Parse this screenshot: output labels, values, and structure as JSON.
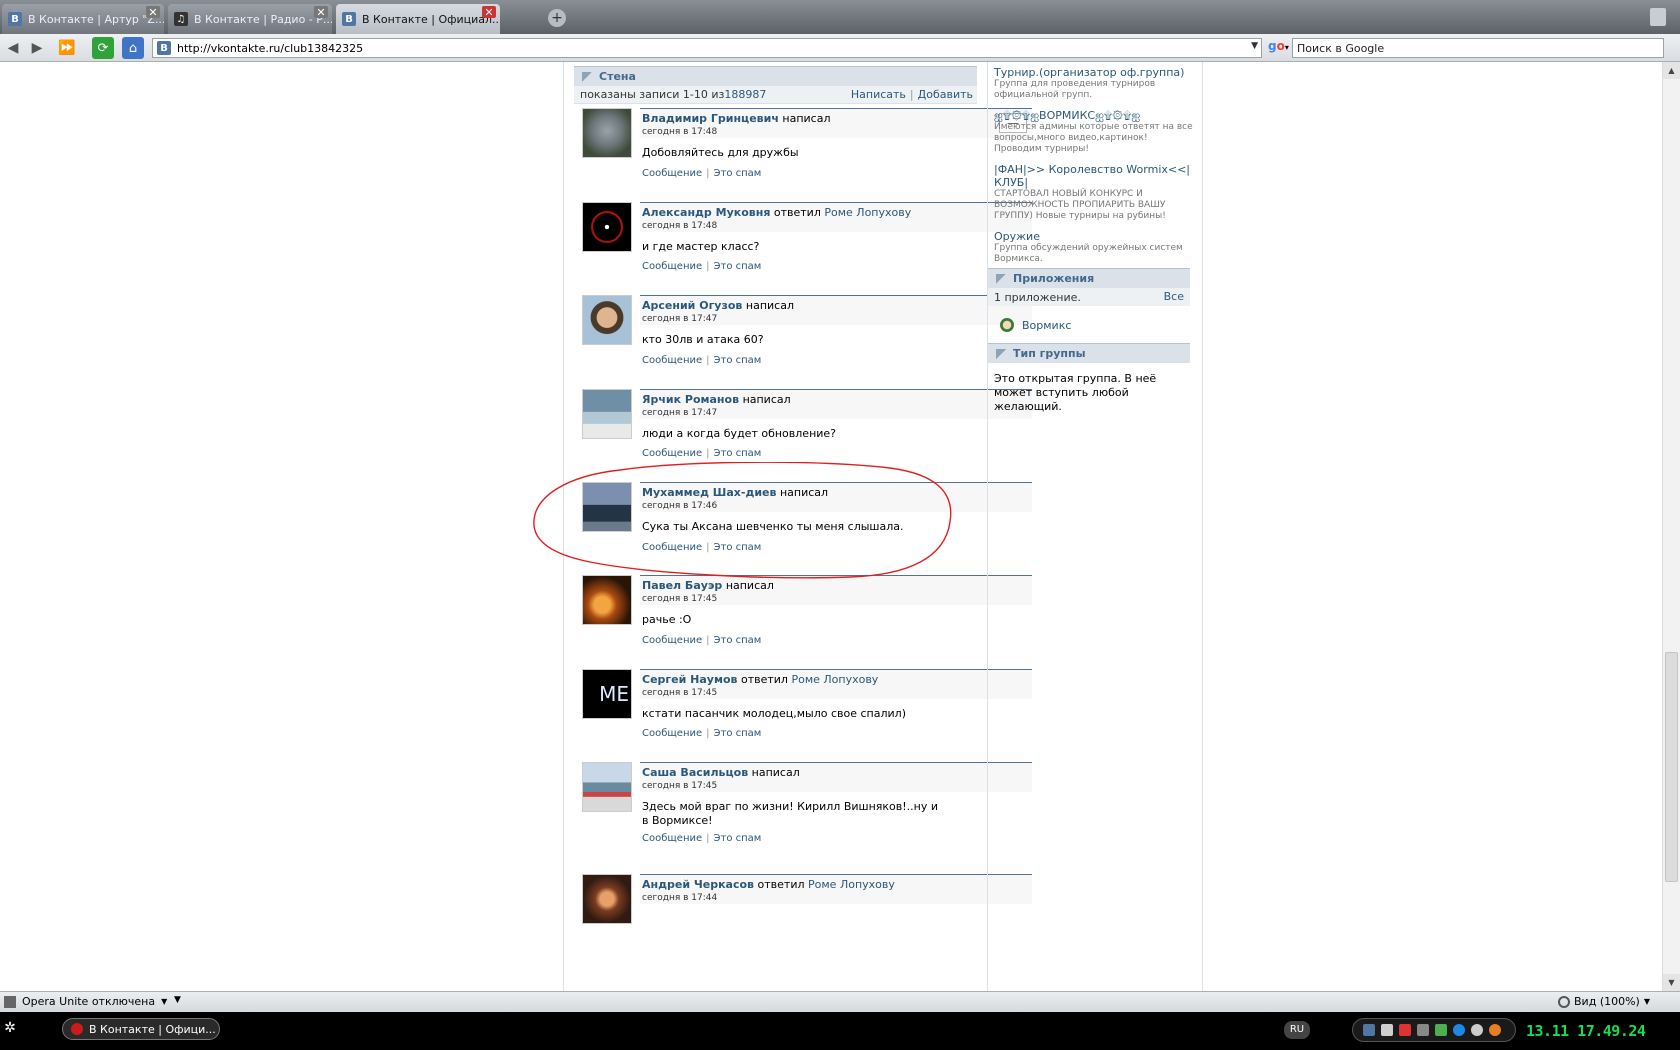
{
  "browser": {
    "tabs": [
      {
        "label": "В Контакте | Артур \"Z...",
        "active": false
      },
      {
        "label": "В Контакте | Радио - Р...",
        "active": false
      },
      {
        "label": "В Контакте | Официал...",
        "active": true
      }
    ],
    "url": "http://vkontakte.ru/club13842325",
    "search_placeholder": "Поиск в Google",
    "favicon_letter": "B"
  },
  "wall": {
    "title": "Стена",
    "shown_prefix": "показаны записи 1-10 из ",
    "total": "188987",
    "write_label": "Написать",
    "add_label": "Добавить",
    "minus_label": "—",
    "posts": [
      {
        "author": "Владимир Гринцевич",
        "action": "написал",
        "target": "",
        "time": "сегодня в 17:48",
        "text": "Добовляйтесь для дружбы",
        "message_label": "Сообщение",
        "spam_label": "Это спам"
      },
      {
        "author": "Александр Муковня",
        "action": "ответил",
        "target": "Роме Лопухову",
        "time": "сегодня в 17:48",
        "text": "и где мастер класс?",
        "message_label": "Сообщение",
        "spam_label": "Это спам"
      },
      {
        "author": "Арсений Огузов",
        "action": "написал",
        "target": "",
        "time": "сегодня в 17:47",
        "text": "кто 30лв и атака 60?",
        "message_label": "Сообщение",
        "spam_label": "Это спам"
      },
      {
        "author": "Ярчик Романов",
        "action": "написал",
        "target": "",
        "time": "сегодня в 17:47",
        "text": "люди а когда будет обновление?",
        "message_label": "Сообщение",
        "spam_label": "Это спам"
      },
      {
        "author": "Мухаммед Шах-диев",
        "action": "написал",
        "target": "",
        "time": "сегодня в 17:46",
        "text": "Сука ты Аксана шевченко ты меня слышала.",
        "message_label": "Сообщение",
        "spam_label": "Это спам"
      },
      {
        "author": "Павел Бауэр",
        "action": "написал",
        "target": "",
        "time": "сегодня в 17:45",
        "text": "рачье :О",
        "message_label": "Сообщение",
        "spam_label": "Это спам"
      },
      {
        "author": "Сергей Наумов",
        "action": "ответил",
        "target": "Роме Лопухову",
        "time": "сегодня в 17:45",
        "text": "кстати пасанчик молодец,мыло свое спалил)",
        "message_label": "Сообщение",
        "spam_label": "Это спам"
      },
      {
        "author": "Саша Васильцов",
        "action": "написал",
        "target": "",
        "time": "сегодня в 17:45",
        "text": "Здесь мой враг по жизни! Кирилл Вишняков!..ну и в Вормиксе!",
        "message_label": "Сообщение",
        "spam_label": "Это спам"
      },
      {
        "author": "Андрей Черкасов",
        "action": "ответил",
        "target": "Роме Лопухову",
        "time": "сегодня в 17:44",
        "text": "",
        "message_label": "Сообщение",
        "spam_label": "Это спам"
      }
    ]
  },
  "sidebar": {
    "groups": [
      {
        "title": "Турнир.(организатор оф.группа)",
        "desc": "Группа для проведения турниров официальной групп."
      },
      {
        "title": "ஐ۩۞۩ஐВОРМИКСஐ۩۞۩ஐ",
        "desc": "Имеются админы которые ответят на все вопросы,много видео,картинок! Проводим турниры!"
      },
      {
        "title": "|ФАН|>> Королевство Wormix<<|КЛУБ|",
        "desc": "СТАРТОВАЛ НОВЫЙ КОНКУРС И ВОЗМОЖНОСТЬ ПРОПИАРИТЬ ВАШУ ГРУППУ) Новые турниры на рубины!"
      },
      {
        "title": "Оружие",
        "desc": "Группа обсуждений оружейных систем Вормикса."
      }
    ],
    "apps_title": "Приложения",
    "apps_count": "1 приложение.",
    "apps_all": "Все",
    "app_name": "Вормикс",
    "type_title": "Тип группы",
    "type_text": "Это открытая группа. В неё может вступить любой желающий."
  },
  "status": {
    "unite": "Opera Unite отключена",
    "zoom": "Вид (100%)"
  },
  "taskbar": {
    "task_label": "В Контакте | Офици...",
    "lang": "RU",
    "clock": "13.11 17.49.24"
  },
  "colors": {
    "link": "#2b587a",
    "header_bg": "#dae1e8",
    "annotation": "#e02020",
    "clock": "#13e04a"
  }
}
